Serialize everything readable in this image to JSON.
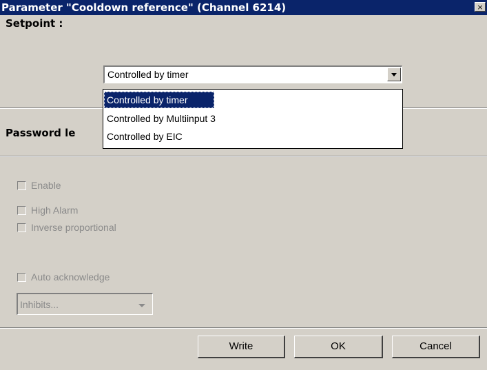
{
  "window": {
    "title": "Parameter \"Cooldown reference\" (Channel 6214)",
    "close_glyph": "×"
  },
  "setpoint": {
    "label": "Setpoint :",
    "selected": "Controlled by timer",
    "options": [
      "Controlled by timer",
      "Controlled by Multiinput 3",
      "Controlled by EIC"
    ]
  },
  "password": {
    "label": "Password le"
  },
  "checkboxes": {
    "enable": "Enable",
    "high_alarm": "High Alarm",
    "inverse_proportional": "Inverse proportional",
    "auto_acknowledge": "Auto acknowledge"
  },
  "inhibits": {
    "value": "Inhibits..."
  },
  "buttons": {
    "write_mnemonic": "W",
    "write_rest": "rite",
    "ok_mnemonic": "O",
    "ok_rest": "K",
    "cancel_mnemonic": "C",
    "cancel_rest": "ancel"
  }
}
